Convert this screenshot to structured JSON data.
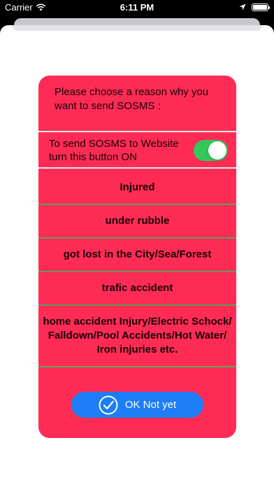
{
  "status_bar": {
    "carrier": "Carrier",
    "time": "6:11 PM"
  },
  "dialog": {
    "prompt": "Please choose a reason why you want to send SOSMS :",
    "toggle_label": "To send SOSMS to Website turn this button ON",
    "toggle_on": true,
    "reasons": [
      "Injured",
      "under rubble",
      "got lost in the City/Sea/Forest",
      "trafic accident",
      "home accident Injury/Electric Schock/\nFalldown/Pool Accidents/Hot Water/\nIron injuries etc."
    ],
    "ok_label": "OK Not yet"
  },
  "colors": {
    "dialog_bg": "#fe2c55",
    "toggle_on": "#34c759",
    "button_bg": "#1c7df6",
    "divider": "#5f9e5f"
  },
  "icons": {
    "wifi": "wifi-icon",
    "location": "location-arrow-icon",
    "battery": "battery-icon",
    "check": "check-circle-icon"
  }
}
